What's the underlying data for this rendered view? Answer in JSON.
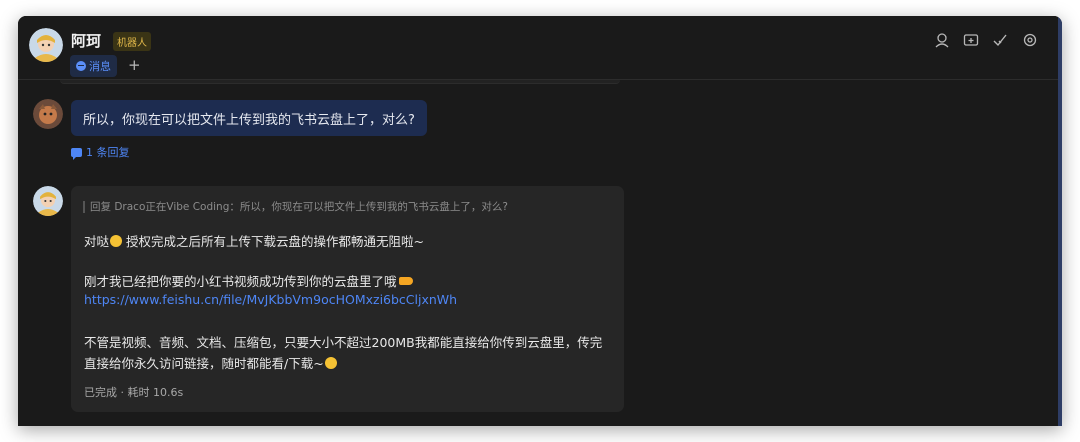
{
  "header": {
    "chat_title": "阿珂",
    "badge": "机器人",
    "tab_label": "消息",
    "add_tab": "+",
    "toolbar_icons": [
      "search-user-icon",
      "add-to-window-icon",
      "check-icon",
      "settings-icon"
    ]
  },
  "messages": {
    "user_message": "所以，你现在可以把文件上传到我的飞书云盘上了，对么?",
    "reply_count": "1 条回复",
    "bot": {
      "quote": "回复 Draco正在Vibe Coding：所以，你现在可以把文件上传到我的飞书云盘上了，对么?",
      "line1": "对哒",
      "line1b": " 授权完成之后所有上传下载云盘的操作都畅通无阻啦~",
      "line2": "刚才我已经把你要的小红书视频成功传到你的云盘里了哦",
      "link": "https://www.feishu.cn/file/MvJKbbVm9ocHOMxzi6bcCljxnWh",
      "line3": "不管是视频、音频、文档、压缩包，只要大小不超过200MB我都能直接给你传到云盘里，传完",
      "line4": "直接给你永久访问链接，随时都能看/下载~",
      "status": "已完成 · 耗时 10.6s"
    }
  },
  "colors": {
    "background": "#1a1a1a",
    "user_bubble": "#1d2c50",
    "link": "#4e86f5",
    "bot_card": "#262626"
  }
}
